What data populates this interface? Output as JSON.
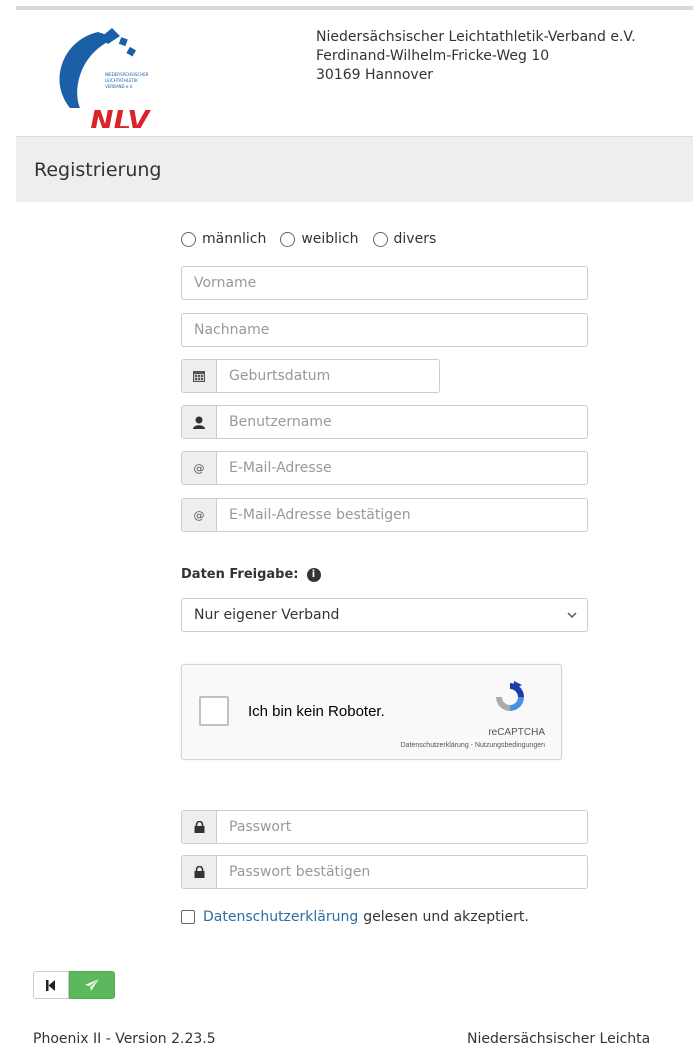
{
  "header": {
    "logo_text": "NLV",
    "logo_small_text": "NIEDERSÄCHSISCHER LEICHTATHLETIK VERBAND e.V.",
    "org_name": "Niedersächsischer Leichtathletik-Verband e.V.",
    "street": "Ferdinand-Wilhelm-Fricke-Weg 10",
    "city": "30169 Hannover"
  },
  "page_title": "Registrierung",
  "gender": {
    "options": [
      "männlich",
      "weiblich",
      "divers"
    ]
  },
  "fields": {
    "vorname": "Vorname",
    "nachname": "Nachname",
    "geburtsdatum": "Geburtsdatum",
    "benutzername": "Benutzername",
    "email": "E-Mail-Adresse",
    "email_confirm": "E-Mail-Adresse bestätigen",
    "passwort": "Passwort",
    "passwort_confirm": "Passwort bestätigen"
  },
  "daten_freigabe": {
    "label": "Daten Freigabe:",
    "info_icon": "info-circle-icon",
    "selected": "Nur eigener Verband"
  },
  "captcha": {
    "label": "Ich bin kein Roboter.",
    "brand": "reCAPTCHA",
    "links": "Datenschutzerklärung - Nutzungsbedingungen"
  },
  "privacy": {
    "link_text": "Datenschutzerklärung",
    "rest_text": "gelesen und akzeptiert."
  },
  "nav": {
    "first_icon": "step-backward-icon",
    "send_icon": "paper-plane-icon"
  },
  "footer": {
    "version": "Phoenix II - Version 2.23.5",
    "org_name": "Niedersächsischer Leichta"
  },
  "colors": {
    "logo_blue": "#1a5fa8",
    "logo_red": "#d9242b",
    "link": "#2a6fa0",
    "send_button": "#5cb85c"
  }
}
